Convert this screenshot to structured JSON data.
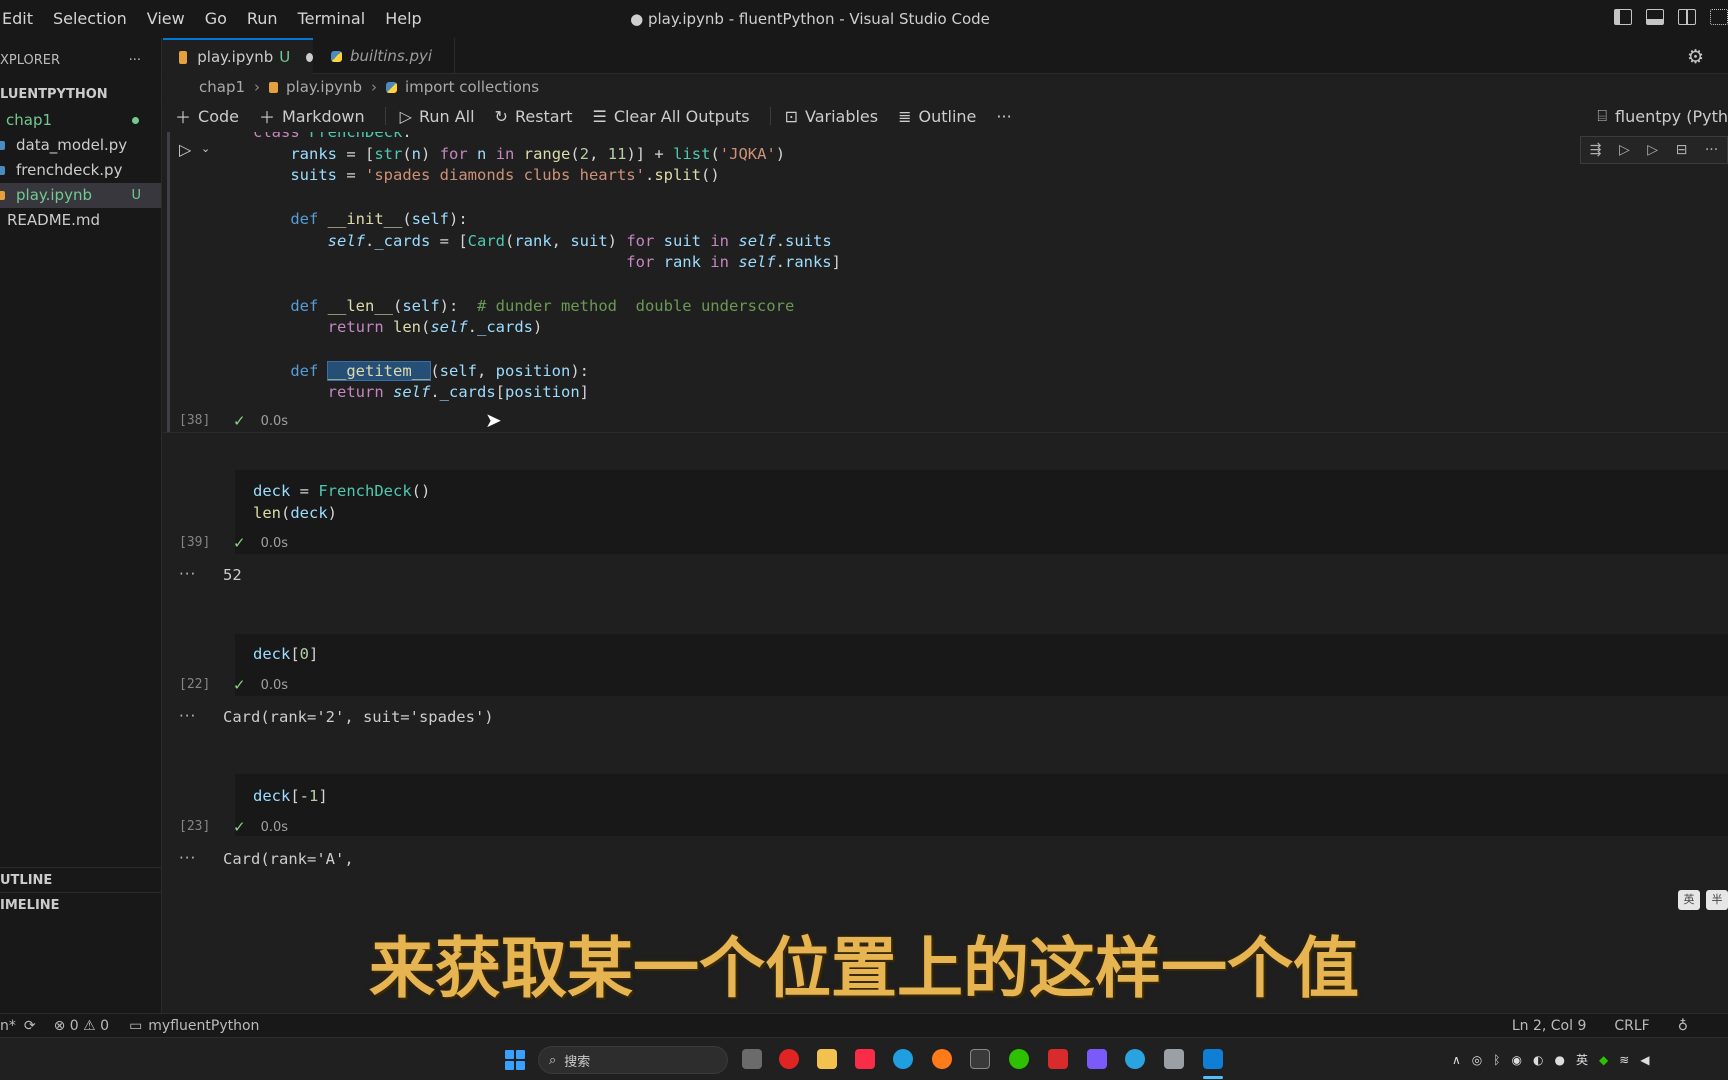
{
  "menu": [
    "Edit",
    "Selection",
    "View",
    "Go",
    "Run",
    "Terminal",
    "Help"
  ],
  "window_title": "● play.ipynb - fluentPython - Visual Studio Code",
  "sidebar": {
    "explorer_label": "XPLORER",
    "more": "···",
    "project": "LUENTPYTHON",
    "items": [
      {
        "name": "chap1",
        "type": "folder"
      },
      {
        "name": "data_model.py",
        "type": "file"
      },
      {
        "name": "frenchdeck.py",
        "type": "file"
      },
      {
        "name": "play.ipynb",
        "type": "file",
        "badge": "U"
      },
      {
        "name": "README.md",
        "type": "file"
      }
    ],
    "outline": "UTLINE",
    "timeline": "IMELINE"
  },
  "tabs": [
    {
      "label": "play.ipynb",
      "badge": "U"
    },
    {
      "label": "builtins.pyi"
    }
  ],
  "breadcrumb": [
    "chap1",
    "play.ipynb",
    "import collections"
  ],
  "toolbar": {
    "code": "Code",
    "markdown": "Markdown",
    "run_all": "Run All",
    "restart": "Restart",
    "clear": "Clear All Outputs",
    "variables": "Variables",
    "outline": "Outline",
    "more": "···",
    "kernel": "fluentpy (Pyth"
  },
  "cells": [
    {
      "exec": "[38]",
      "time": "0.0s"
    },
    {
      "exec": "[39]",
      "time": "0.0s",
      "output": "52"
    },
    {
      "exec": "[22]",
      "time": "0.0s",
      "output": "Card(rank='2', suit='spades')"
    },
    {
      "exec": "[23]",
      "time": "0.0s",
      "output": "Card(rank='A', "
    }
  ],
  "code_cell_2": [
    "deck = FrenchDeck()",
    "len(deck)"
  ],
  "code_cell_3": "deck[0]",
  "code_cell_4": "deck[-1]",
  "subtitle": "来获取某一个位置上的这样一个值",
  "statusbar": {
    "branch": "n*",
    "problems": "⊗ 0 ⚠ 0",
    "folder": "myfluentPython",
    "position": "Ln 2, Col 9",
    "eol": "CRLF"
  },
  "taskbar": {
    "search": "搜索",
    "ime": "英"
  },
  "colors": {
    "accent": "#0078d4",
    "subtitle": "#e7b452",
    "untracked": "#73c991"
  }
}
